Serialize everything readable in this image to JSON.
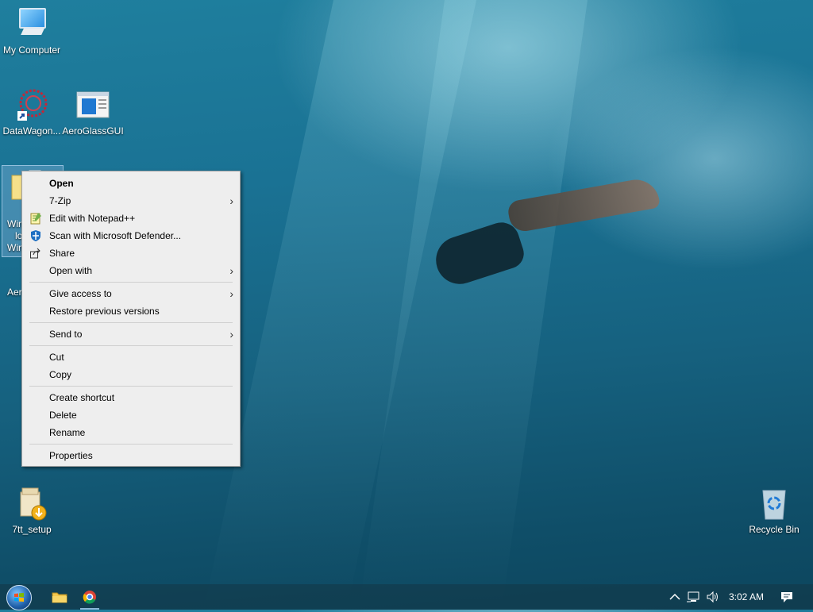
{
  "desktop": {
    "icons": [
      {
        "label": "My Computer"
      },
      {
        "label": "DataWagon..."
      },
      {
        "label": "AeroGlassGUI"
      },
      {
        "label": "7tt_setup"
      },
      {
        "label": "Recycle Bin"
      }
    ],
    "selected_icon_partial_text": [
      "Win",
      "lo",
      "Win"
    ],
    "hidden_icon_partial_text": "Aer"
  },
  "context_menu": {
    "items": [
      {
        "label": "Open",
        "default": true
      },
      {
        "label": "7-Zip",
        "submenu": true
      },
      {
        "label": "Edit with Notepad++",
        "icon": "notepad-plus-icon"
      },
      {
        "label": "Scan with Microsoft Defender...",
        "icon": "defender-shield-icon"
      },
      {
        "label": "Share",
        "icon": "share-icon"
      },
      {
        "label": "Open with",
        "submenu": true
      },
      {
        "label": "Give access to",
        "submenu": true
      },
      {
        "label": "Restore previous versions"
      },
      {
        "label": "Send to",
        "submenu": true
      },
      {
        "label": "Cut"
      },
      {
        "label": "Copy"
      },
      {
        "label": "Create shortcut"
      },
      {
        "label": "Delete"
      },
      {
        "label": "Rename"
      },
      {
        "label": "Properties"
      }
    ],
    "submenu_arrow": "›"
  },
  "taskbar": {
    "clock": "3:02 AM",
    "apps": [
      "file-explorer-icon",
      "chrome-icon"
    ]
  }
}
